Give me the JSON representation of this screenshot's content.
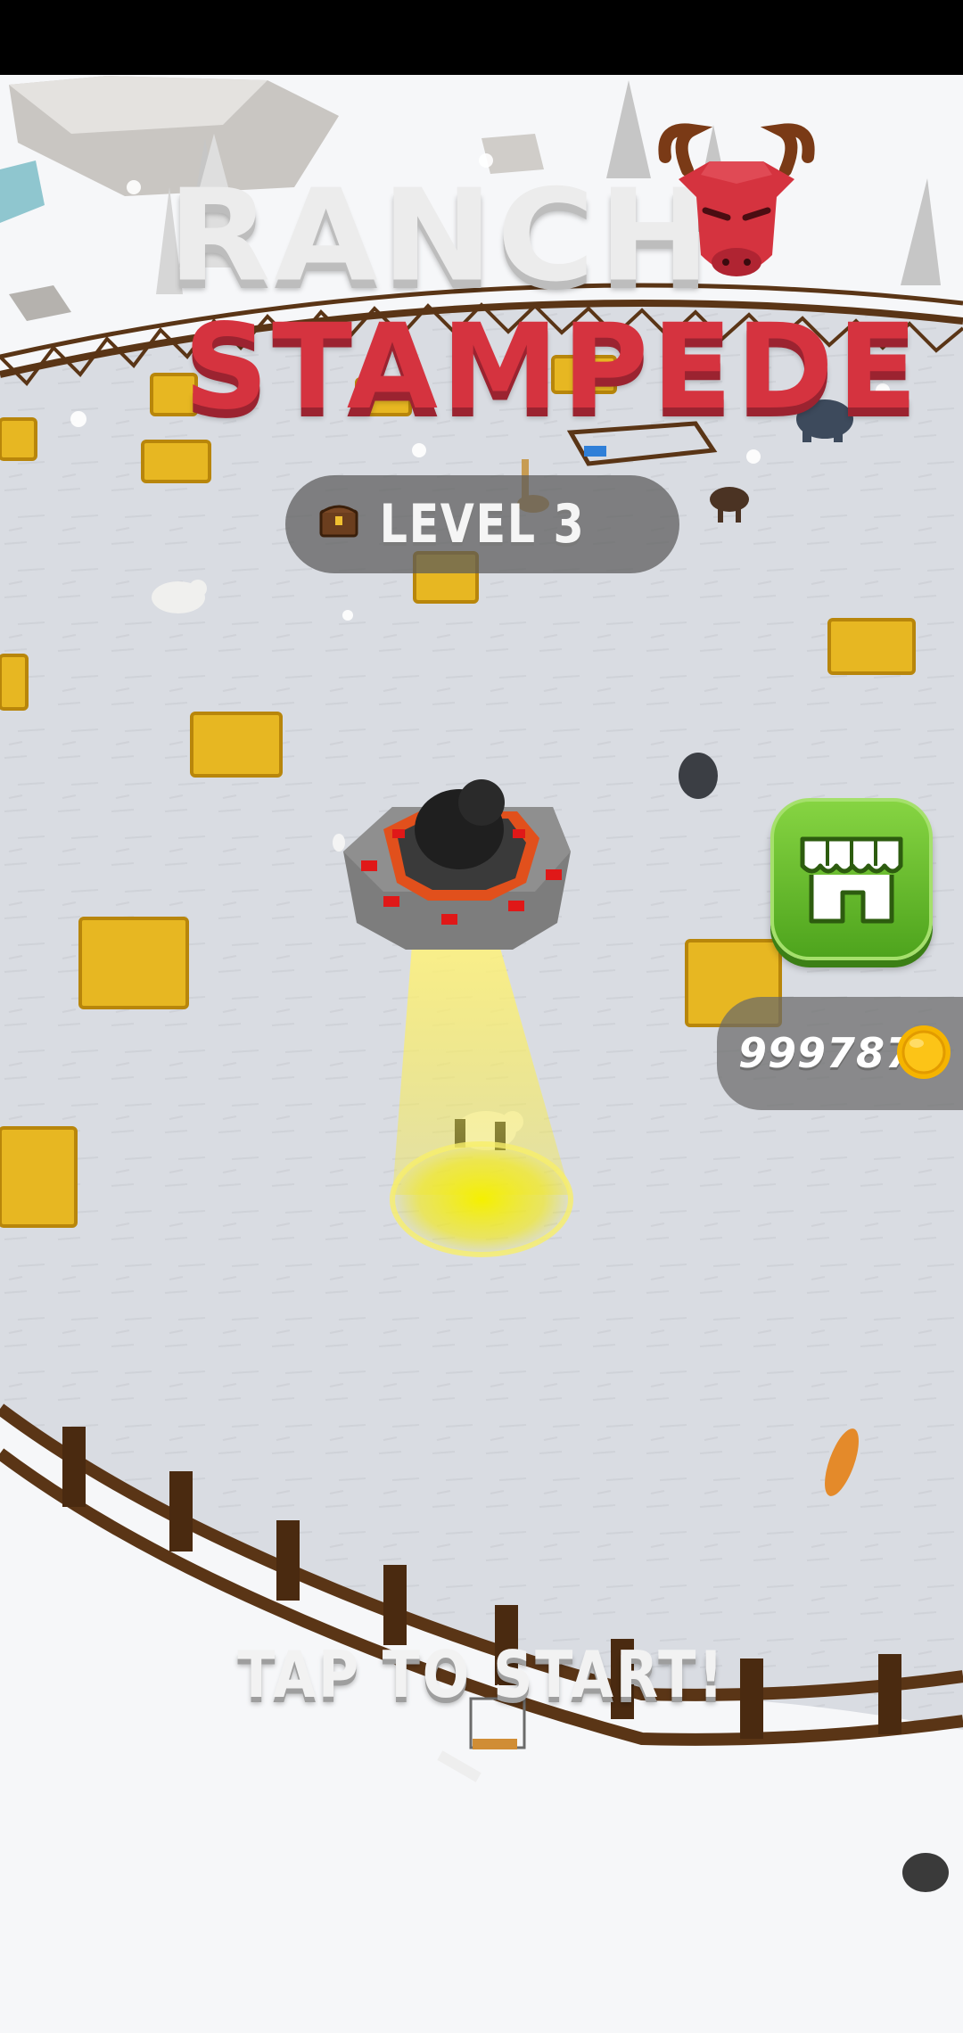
{
  "game": {
    "title_line_1": "RANCH",
    "title_line_2": "STAMPEDE",
    "level_label": "LEVEL 3",
    "coins": "9997879",
    "prompt": "TAP TO START!",
    "icons": {
      "logo": "bull-head-icon",
      "level": "treasure-chest-icon",
      "shop": "shop-icon",
      "coin": "gold-coin-icon"
    }
  },
  "colors": {
    "status_bar": "#000000",
    "snow_ground": "#d8dbe0",
    "title_white": "#ececec",
    "title_red": "#d5333f",
    "shop_green": "#5fb52b",
    "coin_gold": "#f5b400",
    "fence_brown": "#5a3516",
    "hay_yellow": "#e7b722"
  }
}
